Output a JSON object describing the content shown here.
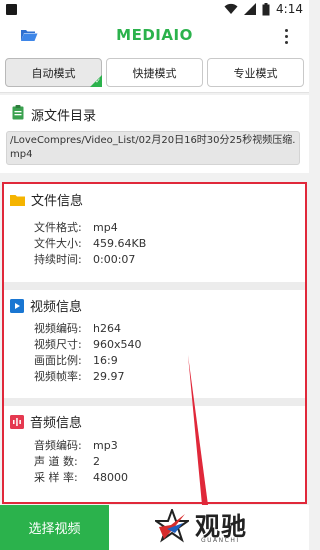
{
  "status_bar": {
    "time": "4:14"
  },
  "app_bar": {
    "title": "MEDIAIO"
  },
  "tabs": [
    {
      "label": "自动模式",
      "active": true
    },
    {
      "label": "快捷模式",
      "active": false
    },
    {
      "label": "专业模式",
      "active": false
    }
  ],
  "source": {
    "label": "源文件目录",
    "path": "/LoveCompres/Video_List/02月20日16时30分25秒视频压缩.mp4"
  },
  "file_info": {
    "title": "文件信息",
    "rows": [
      {
        "key": "文件格式:",
        "value": "mp4"
      },
      {
        "key": "文件大小:",
        "value": "459.64KB"
      },
      {
        "key": "持续时间:",
        "value": "0:00:07"
      }
    ]
  },
  "video_info": {
    "title": "视频信息",
    "rows": [
      {
        "key": "视频编码:",
        "value": "h264"
      },
      {
        "key": "视频尺寸:",
        "value": "960x540"
      },
      {
        "key": "画面比例:",
        "value": "16:9"
      },
      {
        "key": "视频帧率:",
        "value": "29.97"
      }
    ]
  },
  "audio_info": {
    "title": "音频信息",
    "rows": [
      {
        "key": "音频编码:",
        "value": "mp3"
      },
      {
        "key": "声 道 数:",
        "value": "2"
      },
      {
        "key": "采 样 率:",
        "value": "48000"
      }
    ]
  },
  "bottom": {
    "select_button": "选择视频",
    "watermark_cn": "观驰",
    "watermark_en": "GUANCHI"
  },
  "colors": {
    "accent": "#2bb24c",
    "highlight_border": "#e0283a",
    "folder_icon": "#f5b400",
    "video_icon": "#1976d2",
    "audio_icon": "#e53950",
    "clip_icon": "#3aa14f"
  }
}
